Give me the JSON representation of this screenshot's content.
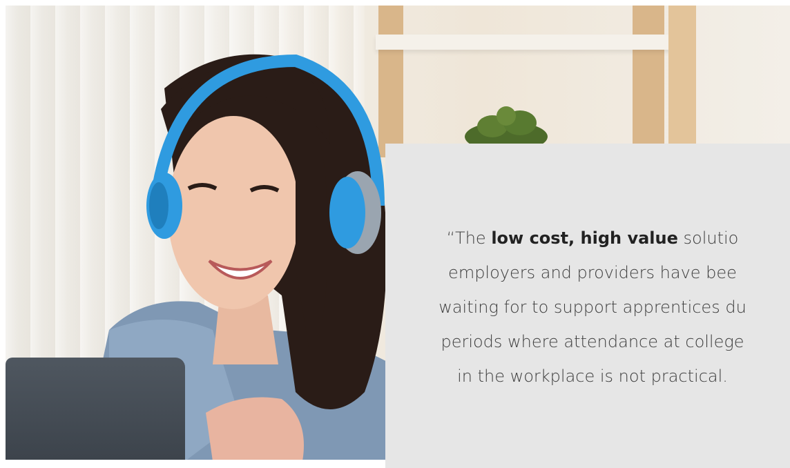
{
  "hero": {
    "image_alt": "Smiling woman wearing blue headphones on a video call at a laptop"
  },
  "quote": {
    "open_quote": "“The ",
    "bold": "low cost, high value",
    "line1_rest": " solutio",
    "line2": "employers and providers have bee",
    "line3": "waiting for to support apprentices du",
    "line4": "periods where attendance at college",
    "line5": "in the workplace is not practical."
  },
  "colors": {
    "card_bg": "#e6e6e6",
    "text": "#3d3d3d",
    "headphones": "#2f9be0"
  }
}
